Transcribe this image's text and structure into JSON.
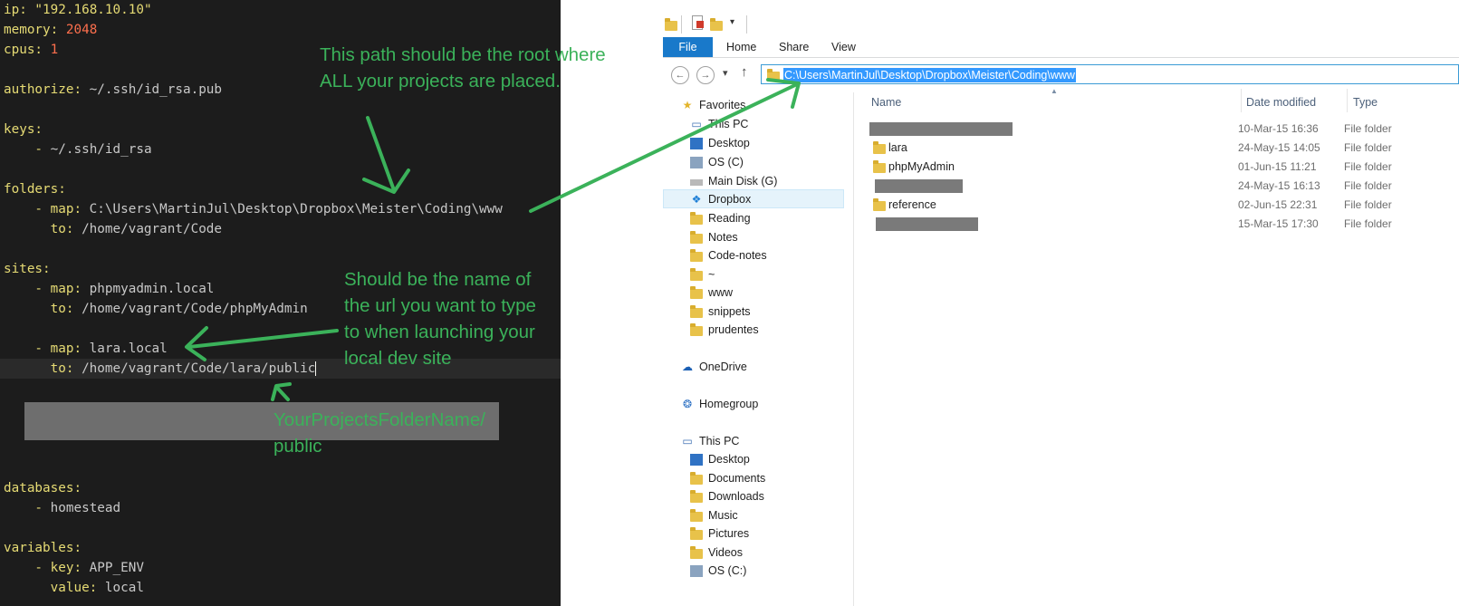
{
  "editor": {
    "lines": [
      {
        "key": "ip:",
        "val": " \"192.168.10.10\""
      },
      {
        "key": "memory:",
        "val": " 2048"
      },
      {
        "key": "cpus:",
        "val": " 1"
      },
      {
        "key": "authorize:",
        "val": " ~/.ssh/id_rsa.pub"
      },
      {
        "key": "keys:",
        "val": ""
      },
      {
        "key": "    - ",
        "val": "~/.ssh/id_rsa"
      },
      {
        "key": "folders:",
        "val": ""
      },
      {
        "key": "    - map:",
        "val": " C:\\Users\\MartinJul\\Desktop\\Dropbox\\Meister\\Coding\\www"
      },
      {
        "key": "      to:",
        "val": " /home/vagrant/Code"
      },
      {
        "key": "sites:",
        "val": ""
      },
      {
        "key": "    - map:",
        "val": " phpmyadmin.local"
      },
      {
        "key": "      to:",
        "val": " /home/vagrant/Code/phpMyAdmin"
      },
      {
        "key": "    - map:",
        "val": " lara.local"
      },
      {
        "key": "      to:",
        "val": " /home/vagrant/Code/lara/public"
      },
      {
        "key": "databases:",
        "val": ""
      },
      {
        "key": "    - ",
        "val": "homestead"
      },
      {
        "key": "variables:",
        "val": ""
      },
      {
        "key": "    - key:",
        "val": " APP_ENV"
      },
      {
        "key": "      value:",
        "val": " local"
      }
    ]
  },
  "annotations": {
    "root_line1": "This path should be the root where",
    "root_line2": "ALL your projects are placed.",
    "url_line1": "Should be the name of",
    "url_line2": "the url you want to type",
    "url_line3": "to when launching your",
    "url_line4": "local dev site",
    "public_line1": "YourProjectsFolderName/",
    "public_line2": "public"
  },
  "explorer": {
    "ribbon_tabs": {
      "file": "File",
      "home": "Home",
      "share": "Share",
      "view": "View"
    },
    "address_path": "C:\\Users\\MartinJul\\Desktop\\Dropbox\\Meister\\Coding\\www",
    "columns": {
      "name": "Name",
      "date": "Date modified",
      "type": "Type"
    },
    "nav": {
      "favorites": "Favorites",
      "fav_this_pc": "This PC",
      "fav_desktop": "Desktop",
      "fav_os": "OS (C)",
      "fav_main_disk": "Main Disk (G)",
      "fav_dropbox": "Dropbox",
      "fav_reading": "Reading",
      "fav_notes": "Notes",
      "fav_code_notes": "Code-notes",
      "fav_tilde": "~",
      "fav_www": "www",
      "fav_snippets": "snippets",
      "fav_prudentes": "prudentes",
      "onedrive": "OneDrive",
      "homegroup": "Homegroup",
      "this_pc": "This PC",
      "pc_desktop": "Desktop",
      "pc_documents": "Documents",
      "pc_downloads": "Downloads",
      "pc_music": "Music",
      "pc_pictures": "Pictures",
      "pc_videos": "Videos",
      "pc_os": "OS (C:)"
    },
    "files": [
      {
        "name": "",
        "date": "10-Mar-15 16:36",
        "type": "File folder"
      },
      {
        "name": "lara",
        "date": "24-May-15 14:05",
        "type": "File folder"
      },
      {
        "name": "phpMyAdmin",
        "date": "01-Jun-15 11:21",
        "type": "File folder"
      },
      {
        "name": "",
        "date": "24-May-15 16:13",
        "type": "File folder"
      },
      {
        "name": "reference",
        "date": "02-Jun-15 22:31",
        "type": "File folder"
      },
      {
        "name": "",
        "date": "15-Mar-15 17:30",
        "type": "File folder"
      }
    ]
  }
}
